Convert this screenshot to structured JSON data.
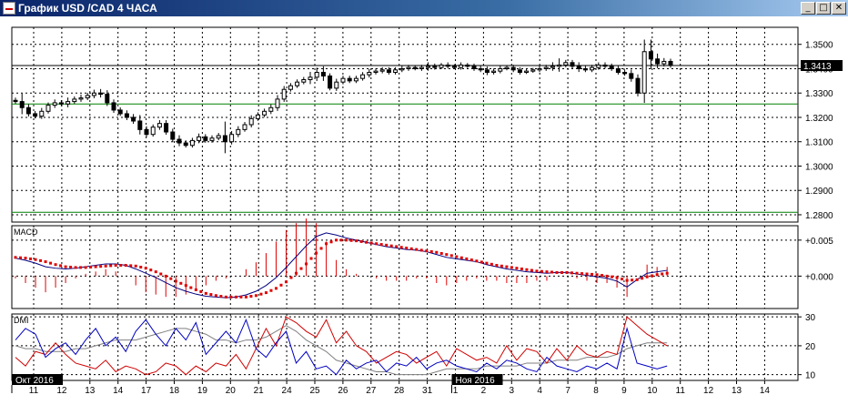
{
  "window": {
    "title": "График USD /CAD  4 ЧАСА",
    "min_glyph": "_",
    "max_glyph": "□",
    "close_glyph": "✕"
  },
  "chart_data": [
    {
      "type": "candlestick",
      "name": "price",
      "yticks": [
        "1.3500",
        "1.3400",
        "1.3300",
        "1.3200",
        "1.3100",
        "1.3000",
        "1.2900",
        "1.2800"
      ],
      "ylim": [
        1.277,
        1.357
      ],
      "current_price_label": "1.3413",
      "current_price": 1.3413,
      "hlines": [
        {
          "value": 1.3413,
          "color": "#000000"
        },
        {
          "value": 1.3255,
          "color": "#008000"
        },
        {
          "value": 1.281,
          "color": "#008000"
        }
      ],
      "grid": true,
      "close": [
        1.3265,
        1.324,
        1.3215,
        1.3205,
        1.3225,
        1.325,
        1.326,
        1.3255,
        1.3265,
        1.3275,
        1.328,
        1.329,
        1.33,
        1.3295,
        1.326,
        1.323,
        1.3215,
        1.32,
        1.3185,
        1.315,
        1.313,
        1.316,
        1.3175,
        1.314,
        1.311,
        1.3095,
        1.3085,
        1.3105,
        1.312,
        1.3105,
        1.3115,
        1.3125,
        1.31,
        1.313,
        1.315,
        1.317,
        1.3195,
        1.321,
        1.3225,
        1.324,
        1.3275,
        1.3315,
        1.333,
        1.3345,
        1.3355,
        1.3365,
        1.3385,
        1.337,
        1.332,
        1.3345,
        1.336,
        1.335,
        1.336,
        1.3375,
        1.3385,
        1.339,
        1.3395,
        1.3385,
        1.3395,
        1.34,
        1.3405,
        1.34,
        1.3405,
        1.341,
        1.3405,
        1.3415,
        1.341,
        1.3405,
        1.3415,
        1.341,
        1.34,
        1.3395,
        1.3385,
        1.339,
        1.34,
        1.3405,
        1.3395,
        1.3385,
        1.339,
        1.3395,
        1.34,
        1.3405,
        1.341,
        1.3415,
        1.3425,
        1.341,
        1.34,
        1.3395,
        1.3405,
        1.3415,
        1.341,
        1.34,
        1.3385,
        1.338,
        1.336,
        1.33,
        1.347,
        1.344,
        1.342,
        1.343,
        1.3413
      ],
      "wick": [
        0.002,
        0.006,
        0.0025,
        0.002,
        0.0025,
        0.002,
        0.0025,
        0.002,
        0.003,
        0.002,
        0.0025,
        0.002,
        0.0025,
        0.003,
        0.003,
        0.0025,
        0.002,
        0.0025,
        0.0025,
        0.0045,
        0.0025,
        0.002,
        0.0025,
        0.0025,
        0.0025,
        0.003,
        0.002,
        0.002,
        0.0025,
        0.002,
        0.002,
        0.002,
        0.0105,
        0.0025,
        0.0025,
        0.002,
        0.0025,
        0.002,
        0.002,
        0.0025,
        0.003,
        0.0025,
        0.002,
        0.002,
        0.002,
        0.004,
        0.0035,
        0.0045,
        0.002,
        0.0025,
        0.002,
        0.002,
        0.002,
        0.002,
        0.0025,
        0.002,
        0.002,
        0.002,
        0.002,
        0.002,
        0.002,
        0.0015,
        0.002,
        0.003,
        0.002,
        0.0015,
        0.002,
        0.0015,
        0.002,
        0.0015,
        0.002,
        0.002,
        0.0025,
        0.002,
        0.002,
        0.0015,
        0.002,
        0.002,
        0.0015,
        0.0015,
        0.002,
        0.002,
        0.003,
        0.005,
        0.002,
        0.002,
        0.003,
        0.002,
        0.002,
        0.002,
        0.002,
        0.002,
        0.002,
        0.002,
        0.003,
        0.003,
        0.009,
        0.009,
        0.004,
        0.0025,
        0.002
      ]
    },
    {
      "type": "line",
      "name": "MACD",
      "label": "MACD",
      "yticks": [
        "+0.005",
        "+0.000"
      ],
      "ylim": [
        -0.0045,
        0.007
      ],
      "macd": [
        0.0025,
        0.0022,
        0.0018,
        0.0013,
        0.0011,
        0.001,
        0.0011,
        0.0013,
        0.0015,
        0.0017,
        0.0017,
        0.0015,
        0.001,
        0.0004,
        -0.0002,
        -0.0009,
        -0.0016,
        -0.0021,
        -0.0025,
        -0.0028,
        -0.0029,
        -0.003,
        -0.0029,
        -0.0026,
        -0.0021,
        -0.0013,
        -0.0002,
        0.0012,
        0.0027,
        0.0042,
        0.0055,
        0.006,
        0.0057,
        0.0053,
        0.005,
        0.0047,
        0.0044,
        0.0041,
        0.0039,
        0.0037,
        0.0036,
        0.0034,
        0.003,
        0.0026,
        0.0024,
        0.0022,
        0.002,
        0.0016,
        0.0013,
        0.001,
        0.0008,
        0.0006,
        0.0005,
        0.0004,
        0.0005,
        0.0005,
        0.0003,
        0.0001,
        -0.0001,
        -0.0003,
        -0.0007,
        -0.0015,
        -0.0005,
        0.0004,
        0.0006,
        0.0008
      ],
      "signal": [
        0.0026,
        0.0025,
        0.0023,
        0.002,
        0.0016,
        0.0013,
        0.0012,
        0.0012,
        0.0013,
        0.0014,
        0.0015,
        0.0015,
        0.0014,
        0.0011,
        0.0006,
        0.0,
        -0.0007,
        -0.0013,
        -0.0019,
        -0.0024,
        -0.0027,
        -0.0029,
        -0.0029,
        -0.0029,
        -0.0027,
        -0.0023,
        -0.0017,
        -0.0008,
        0.0004,
        0.0017,
        0.0032,
        0.0045,
        0.005,
        0.005,
        0.0049,
        0.0047,
        0.0045,
        0.0043,
        0.0041,
        0.0039,
        0.0037,
        0.0035,
        0.0033,
        0.003,
        0.0027,
        0.0024,
        0.0021,
        0.0018,
        0.0015,
        0.0013,
        0.0011,
        0.0009,
        0.0007,
        0.0006,
        0.0005,
        0.0005,
        0.0004,
        0.0003,
        0.0002,
        0.0,
        -0.0002,
        -0.0006,
        -0.0005,
        -0.0001,
        0.0002,
        0.0004
      ]
    },
    {
      "type": "line",
      "name": "DMI",
      "label": "DMI",
      "yticks": [
        "30",
        "20",
        "10"
      ],
      "ylim": [
        8,
        31
      ],
      "plus_di": [
        22,
        26,
        24,
        16,
        19,
        21,
        17,
        22,
        26,
        20,
        23,
        18,
        25,
        29,
        24,
        20,
        26,
        22,
        28,
        17,
        21,
        25,
        21,
        29,
        19,
        16,
        21,
        25,
        14,
        18,
        12,
        13,
        10,
        15,
        12,
        14,
        15,
        11,
        14,
        13,
        16,
        12,
        14,
        15,
        13,
        12,
        11,
        14,
        12,
        15,
        14,
        12,
        11,
        16,
        13,
        12,
        11,
        13,
        12,
        14,
        12,
        26,
        14,
        13,
        12,
        13
      ],
      "minus_di": [
        16,
        13,
        18,
        17,
        21,
        17,
        14,
        13,
        12,
        15,
        11,
        13,
        12,
        10,
        11,
        14,
        13,
        10,
        13,
        11,
        14,
        13,
        17,
        12,
        19,
        26,
        20,
        30,
        28,
        25,
        23,
        29,
        21,
        25,
        20,
        18,
        14,
        16,
        18,
        17,
        14,
        16,
        18,
        13,
        19,
        17,
        15,
        16,
        14,
        20,
        15,
        19,
        18,
        14,
        19,
        15,
        20,
        17,
        16,
        18,
        17,
        30,
        27,
        24,
        22,
        20
      ],
      "adx": [
        20,
        19,
        19,
        18,
        18,
        18,
        19,
        19,
        20,
        21,
        22,
        22,
        22,
        23,
        24,
        25,
        26,
        26,
        25,
        24,
        22,
        22,
        21,
        22,
        22,
        23,
        25,
        27,
        25,
        22,
        20,
        18,
        15,
        14,
        13,
        12,
        11,
        11,
        10,
        10,
        10,
        10,
        11,
        12,
        12,
        12,
        12,
        13,
        13,
        13,
        13,
        14,
        14,
        14,
        15,
        15,
        15,
        16,
        16,
        16,
        17,
        19,
        20,
        21,
        21,
        21
      ]
    }
  ],
  "x_axis": {
    "labels": [
      "11",
      "12",
      "13",
      "14",
      "17",
      "18",
      "19",
      "20",
      "21",
      "24",
      "25",
      "26",
      "27",
      "28",
      "31",
      "1",
      "2",
      "3",
      "4",
      "7",
      "8",
      "9",
      "10",
      "11",
      "12",
      "13",
      "14"
    ],
    "period_labels": [
      {
        "text": "Окт 2016",
        "at_label_index": 0
      },
      {
        "text": "Ноя 2016",
        "at_label_index": 15
      }
    ]
  },
  "colors": {
    "bull": "#ffffff",
    "bear": "#000000",
    "macd_line": "#000080",
    "signal_line": "#e00000",
    "histogram": "#e00000",
    "plus_di": "#0000c0",
    "minus_di": "#d00000",
    "adx": "#808080",
    "grid": "#000000",
    "green_level": "#008000"
  }
}
